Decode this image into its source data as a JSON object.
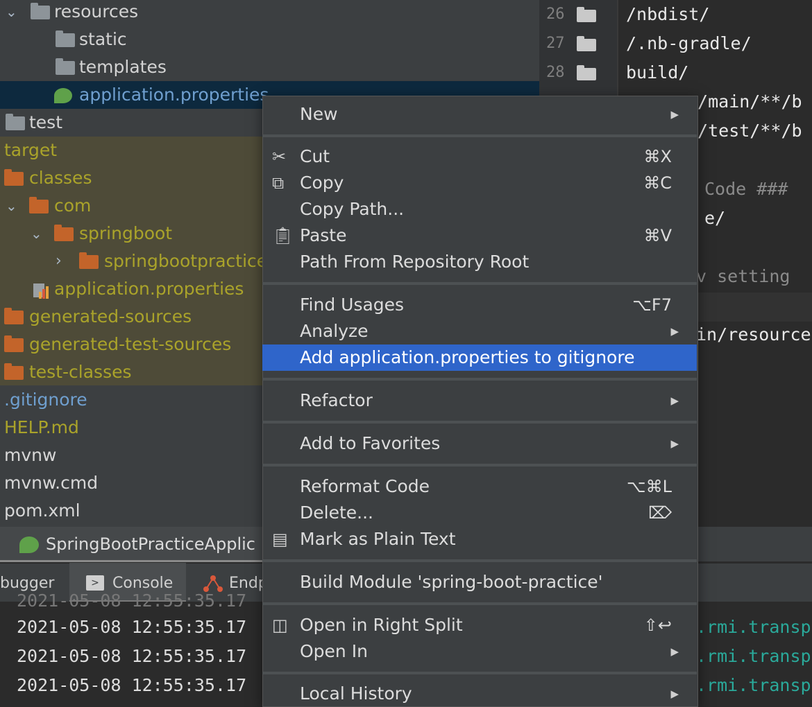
{
  "tree": {
    "rows": [
      {
        "label": "resources"
      },
      {
        "label": "static"
      },
      {
        "label": "templates"
      },
      {
        "label": "application.properties"
      },
      {
        "label": "test"
      },
      {
        "label": "target"
      },
      {
        "label": "classes"
      },
      {
        "label": "com"
      },
      {
        "label": "springboot"
      },
      {
        "label": "springbootpractice"
      },
      {
        "label": "application.properties"
      },
      {
        "label": "generated-sources"
      },
      {
        "label": "generated-test-sources"
      },
      {
        "label": "test-classes"
      },
      {
        "label": ".gitignore"
      },
      {
        "label": "HELP.md"
      },
      {
        "label": "mvnw"
      },
      {
        "label": "mvnw.cmd"
      },
      {
        "label": "pom.xml"
      }
    ]
  },
  "editor": {
    "line_numbers": [
      "26",
      "27",
      "28"
    ],
    "lines": [
      "/nbdist/",
      "/.nb-gradle/",
      "build/",
      "c/main/**/b",
      "c/test/**/b",
      "",
      "Code ###",
      "e/",
      "",
      "v setting",
      "",
      "in/resource"
    ]
  },
  "run": {
    "config_label": "SpringBootPracticeApplic",
    "tabs": [
      "bugger",
      "Console",
      "Endp"
    ]
  },
  "console": {
    "lines": [
      "2021-05-08 12:55:35.17",
      "2021-05-08 12:55:35.17",
      "2021-05-08 12:55:35.17"
    ],
    "right": [
      ".rmi.transp",
      ".rmi.transp",
      ".rmi.transp"
    ]
  },
  "menu": {
    "items": [
      {
        "label": "New",
        "shortcut": "",
        "submenu": true
      },
      {
        "label": "Cut",
        "shortcut": "⌘X",
        "icon": "cut-icon"
      },
      {
        "label": "Copy",
        "shortcut": "⌘C",
        "icon": "copy-icon"
      },
      {
        "label": "Copy Path...",
        "shortcut": ""
      },
      {
        "label": "Paste",
        "shortcut": "⌘V",
        "icon": "paste-icon"
      },
      {
        "label": "Path From Repository Root",
        "shortcut": ""
      },
      {
        "label": "Find Usages",
        "shortcut": "⌥F7"
      },
      {
        "label": "Analyze",
        "shortcut": "",
        "submenu": true
      },
      {
        "label": "Add application.properties to gitignore",
        "shortcut": "",
        "highlighted": true
      },
      {
        "label": "Refactor",
        "shortcut": "",
        "submenu": true
      },
      {
        "label": "Add to Favorites",
        "shortcut": "",
        "submenu": true
      },
      {
        "label": "Reformat Code",
        "shortcut": "⌥⌘L"
      },
      {
        "label": "Delete...",
        "shortcut": "⌦"
      },
      {
        "label": "Mark as Plain Text",
        "shortcut": "",
        "icon": "plain-text-icon"
      },
      {
        "label": "Build Module 'spring-boot-practice'",
        "shortcut": ""
      },
      {
        "label": "Open in Right Split",
        "shortcut": "⇧↩",
        "icon": "split-icon"
      },
      {
        "label": "Open In",
        "shortcut": "",
        "submenu": true
      },
      {
        "label": "Local History",
        "shortcut": "",
        "submenu": true
      }
    ]
  },
  "colors": {
    "highlight": "#2f65ca",
    "excluded_bg": "#4e4b38",
    "selected_bg": "#0d293e"
  }
}
